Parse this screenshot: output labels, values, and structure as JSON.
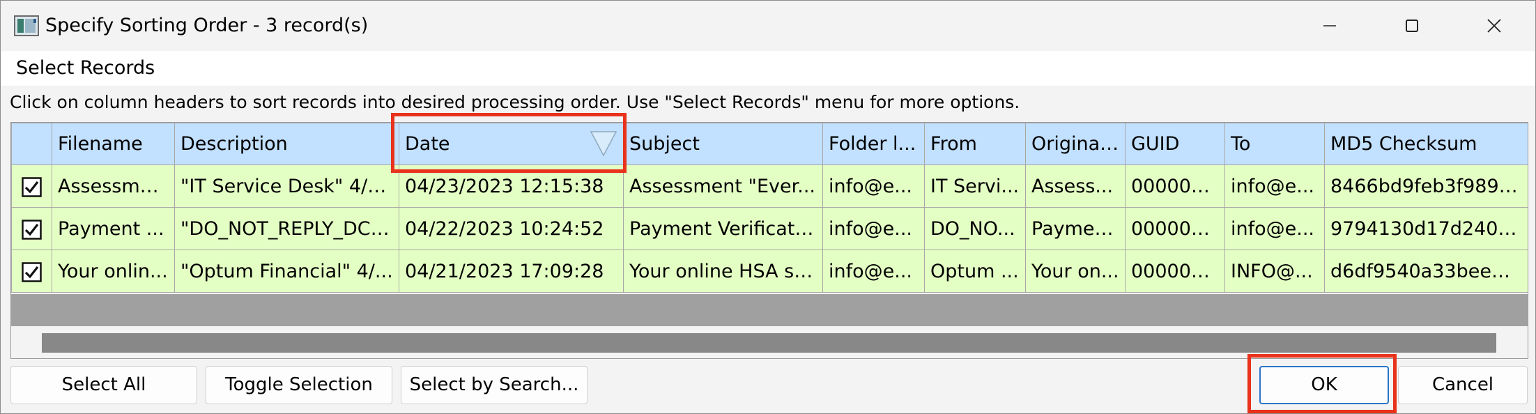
{
  "window": {
    "title": "Specify Sorting Order - 3 record(s)"
  },
  "menu": {
    "items": [
      "Select Records"
    ]
  },
  "instruction": "Click on column headers to sort records into desired processing order. Use \"Select Records\" menu for more options.",
  "table": {
    "columns": [
      "",
      "Filename",
      "Description",
      "Date",
      "Subject",
      "Folder l...",
      "From",
      "Original...",
      "GUID",
      "To",
      "MD5 Checksum"
    ],
    "sorted_column": "Date",
    "sort_direction": "descending",
    "rows": [
      {
        "checked": true,
        "cells": [
          "Assessme...",
          "\"IT Service Desk\" 4/2...",
          "04/23/2023 12:15:38",
          "Assessment \"Ever...",
          "info@e...",
          "IT Servi...",
          "Assess...",
          "000000...",
          "info@e...",
          "8466bd9feb3f9890..."
        ]
      },
      {
        "checked": true,
        "cells": [
          "Payment ...",
          "\"DO_NOT_REPLY_DCI...",
          "04/22/2023 10:24:52",
          "Payment Verificati...",
          "info@e...",
          "DO_NO...",
          "Paymen...",
          "000000...",
          "info@e...",
          "9794130d17d240d..."
        ]
      },
      {
        "checked": true,
        "cells": [
          "Your onlin...",
          "\"Optum Financial\" 4/...",
          "04/21/2023 17:09:28",
          "Your online HSA st...",
          "info@e...",
          "Optum ...",
          "Your on...",
          "000000...",
          "INFO@...",
          "d6df9540a33beed2..."
        ]
      }
    ]
  },
  "buttons": {
    "select_all": "Select All",
    "toggle_selection": "Toggle Selection",
    "select_by_search": "Select by Search...",
    "ok": "OK",
    "cancel": "Cancel"
  },
  "colors": {
    "header_bg": "#c2e0ff",
    "row_bg": "#e4ffc4",
    "highlight": "#e8321c",
    "ok_border": "#2b74c7"
  },
  "icons": {
    "app": "app-icon",
    "minimize": "minimize-icon",
    "maximize": "maximize-icon",
    "close": "close-icon",
    "sort": "sort-descending-icon",
    "checkbox": "checkbox-checked-icon"
  }
}
